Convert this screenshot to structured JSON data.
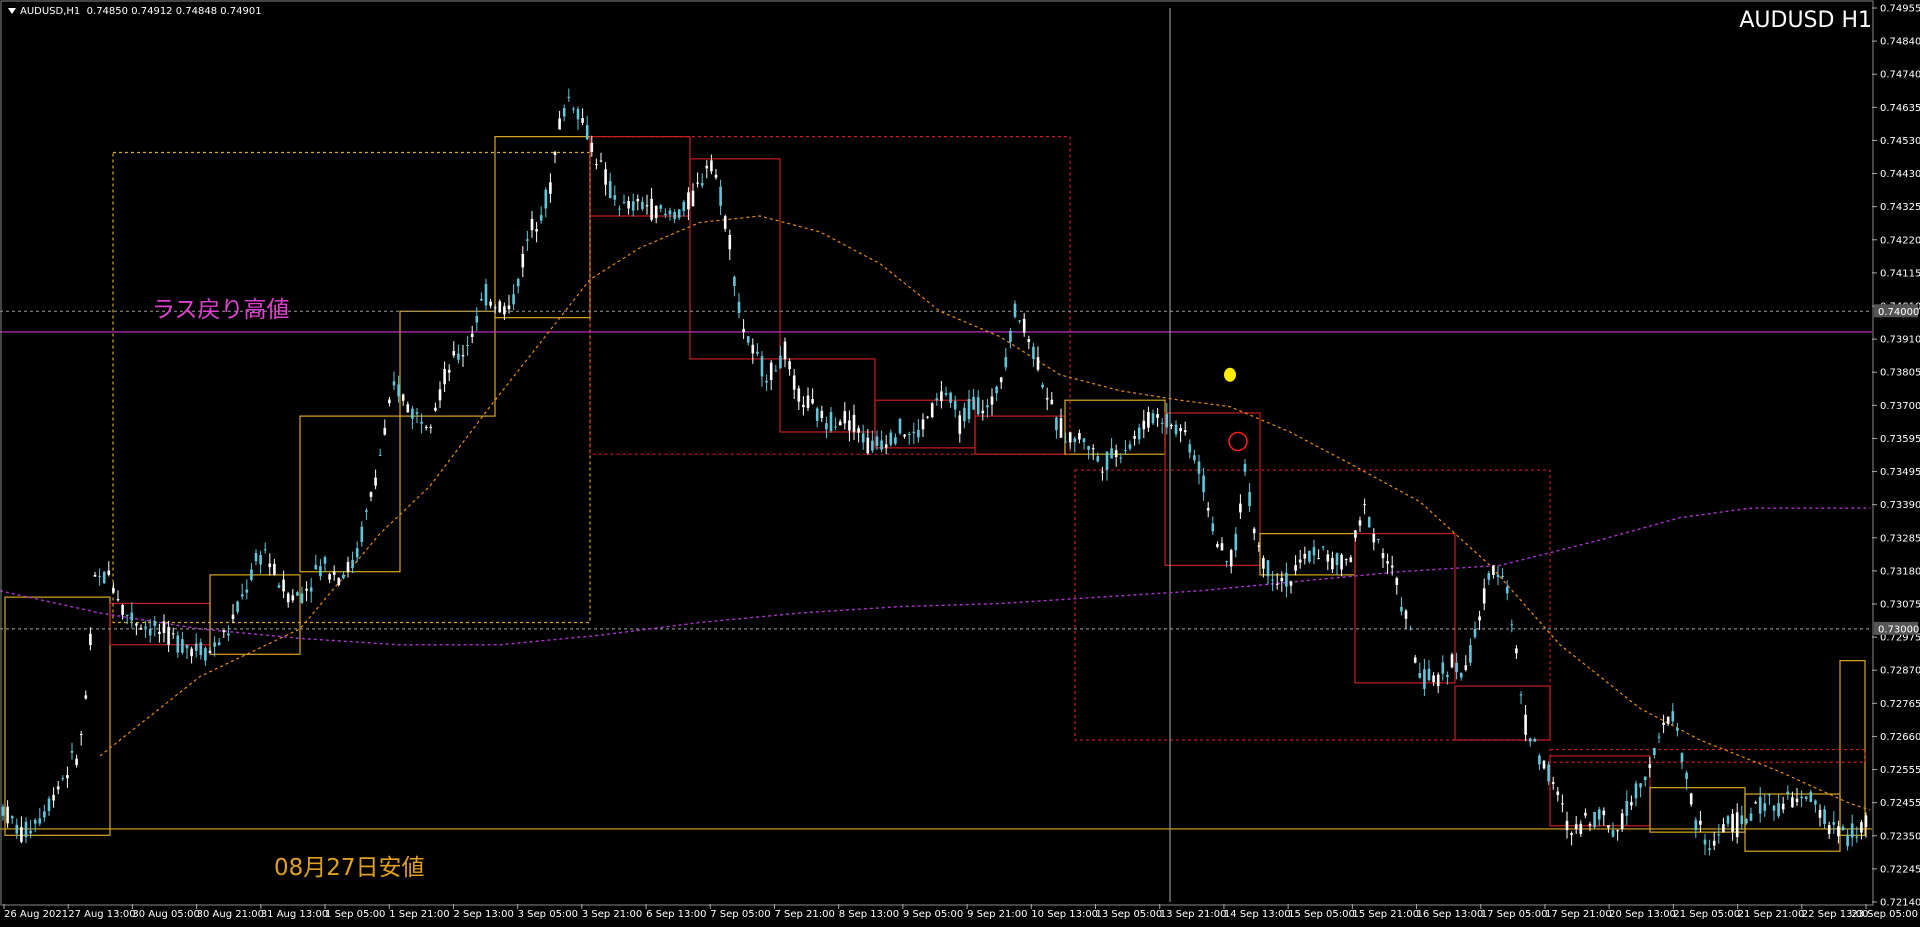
{
  "header": {
    "symbol": "AUDUSD,H1",
    "ohlc": "0.74850 0.74912 0.74848 0.74901"
  },
  "title_big": "AUDUSD H1",
  "annotations": {
    "resistance_label": "ラス戻り高値",
    "support_label": "08月27日安値"
  },
  "colors": {
    "background": "#000000",
    "candle": "#5fc8dc",
    "candle_bull": "#ffffff",
    "yellow": "#d8a820",
    "red": "#c81e1e",
    "magenta": "#cc33cc",
    "orange_ma": "#e88a1a",
    "purple_ma": "#aa33cc",
    "grid": "#777777"
  },
  "chart_data": {
    "type": "candlestick",
    "instrument": "AUDUSD",
    "timeframe": "H1",
    "ylim": [
      0.7214,
      0.74955
    ],
    "y_ticks": [
      "0.74955",
      "0.74840",
      "0.74740",
      "0.74635",
      "0.74530",
      "0.74430",
      "0.74325",
      "0.74220",
      "0.74115",
      "0.74010",
      "0.73910",
      "0.73805",
      "0.73700",
      "0.73595",
      "0.73495",
      "0.73390",
      "0.73285",
      "0.73180",
      "0.73075",
      "0.72975",
      "0.72870",
      "0.72765",
      "0.72660",
      "0.72555",
      "0.72455",
      "0.72350",
      "0.72245",
      "0.72140"
    ],
    "y_labels_highlight": [
      {
        "label": "0.74000",
        "value": 0.74
      },
      {
        "label": "0.73000",
        "value": 0.73
      }
    ],
    "x_labels": [
      "26 Aug 2021",
      "27 Aug 13:00",
      "30 Aug 05:00",
      "30 Aug 21:00",
      "31 Aug 13:00",
      "1 Sep 05:00",
      "1 Sep 21:00",
      "2 Sep 13:00",
      "3 Sep 05:00",
      "3 Sep 21:00",
      "6 Sep 13:00",
      "7 Sep 05:00",
      "7 Sep 21:00",
      "8 Sep 13:00",
      "9 Sep 05:00",
      "9 Sep 21:00",
      "10 Sep 13:00",
      "13 Sep 05:00",
      "13 Sep 21:00",
      "14 Sep 13:00",
      "15 Sep 05:00",
      "15 Sep 21:00",
      "16 Sep 13:00",
      "17 Sep 05:00",
      "17 Sep 21:00",
      "20 Sep 13:00",
      "21 Sep 05:00",
      "21 Sep 21:00",
      "22 Sep 13:00",
      "23 Sep 05:00"
    ],
    "price_path": [
      [
        0,
        0.7245
      ],
      [
        22,
        0.7235
      ],
      [
        45,
        0.7243
      ],
      [
        60,
        0.7252
      ],
      [
        80,
        0.7262
      ],
      [
        88,
        0.7285
      ],
      [
        95,
        0.7315
      ],
      [
        110,
        0.7317
      ],
      [
        125,
        0.7305
      ],
      [
        140,
        0.7302
      ],
      [
        160,
        0.7299
      ],
      [
        185,
        0.7295
      ],
      [
        210,
        0.7293
      ],
      [
        230,
        0.73
      ],
      [
        245,
        0.7312
      ],
      [
        255,
        0.732
      ],
      [
        265,
        0.7325
      ],
      [
        275,
        0.7317
      ],
      [
        285,
        0.7312
      ],
      [
        295,
        0.731
      ],
      [
        305,
        0.7312
      ],
      [
        315,
        0.7318
      ],
      [
        325,
        0.732
      ],
      [
        340,
        0.7317
      ],
      [
        355,
        0.7321
      ],
      [
        375,
        0.7347
      ],
      [
        395,
        0.7377
      ],
      [
        415,
        0.7367
      ],
      [
        430,
        0.7367
      ],
      [
        450,
        0.7383
      ],
      [
        465,
        0.7388
      ],
      [
        485,
        0.7405
      ],
      [
        510,
        0.74
      ],
      [
        530,
        0.7425
      ],
      [
        550,
        0.7438
      ],
      [
        560,
        0.746
      ],
      [
        570,
        0.7468
      ],
      [
        580,
        0.7462
      ],
      [
        595,
        0.745
      ],
      [
        610,
        0.7438
      ],
      [
        625,
        0.7432
      ],
      [
        645,
        0.7434
      ],
      [
        665,
        0.743
      ],
      [
        685,
        0.7432
      ],
      [
        700,
        0.744
      ],
      [
        710,
        0.745
      ],
      [
        720,
        0.7437
      ],
      [
        730,
        0.7422
      ],
      [
        740,
        0.7398
      ],
      [
        755,
        0.7385
      ],
      [
        770,
        0.738
      ],
      [
        785,
        0.7387
      ],
      [
        795,
        0.7375
      ],
      [
        810,
        0.737
      ],
      [
        825,
        0.7365
      ],
      [
        840,
        0.7367
      ],
      [
        855,
        0.7365
      ],
      [
        870,
        0.7357
      ],
      [
        885,
        0.736
      ],
      [
        900,
        0.7363
      ],
      [
        915,
        0.736
      ],
      [
        930,
        0.7368
      ],
      [
        945,
        0.7375
      ],
      [
        960,
        0.7365
      ],
      [
        975,
        0.7372
      ],
      [
        990,
        0.7368
      ],
      [
        1005,
        0.7385
      ],
      [
        1015,
        0.74
      ],
      [
        1025,
        0.7395
      ],
      [
        1040,
        0.7382
      ],
      [
        1055,
        0.7365
      ],
      [
        1070,
        0.736
      ],
      [
        1085,
        0.736
      ],
      [
        1100,
        0.7352
      ],
      [
        1115,
        0.7355
      ],
      [
        1135,
        0.736
      ],
      [
        1155,
        0.7368
      ],
      [
        1170,
        0.7365
      ],
      [
        1185,
        0.7362
      ],
      [
        1200,
        0.735
      ],
      [
        1215,
        0.733
      ],
      [
        1225,
        0.732
      ],
      [
        1235,
        0.7325
      ],
      [
        1245,
        0.735
      ],
      [
        1255,
        0.733
      ],
      [
        1265,
        0.732
      ],
      [
        1275,
        0.7317
      ],
      [
        1290,
        0.7315
      ],
      [
        1305,
        0.7322
      ],
      [
        1320,
        0.7325
      ],
      [
        1335,
        0.732
      ],
      [
        1350,
        0.7322
      ],
      [
        1365,
        0.7338
      ],
      [
        1375,
        0.733
      ],
      [
        1390,
        0.732
      ],
      [
        1405,
        0.7305
      ],
      [
        1420,
        0.7285
      ],
      [
        1435,
        0.7283
      ],
      [
        1450,
        0.729
      ],
      [
        1465,
        0.7285
      ],
      [
        1480,
        0.7305
      ],
      [
        1495,
        0.732
      ],
      [
        1505,
        0.7318
      ],
      [
        1515,
        0.7295
      ],
      [
        1525,
        0.727
      ],
      [
        1540,
        0.726
      ],
      [
        1555,
        0.725
      ],
      [
        1570,
        0.7235
      ],
      [
        1585,
        0.724
      ],
      [
        1600,
        0.7242
      ],
      [
        1615,
        0.7236
      ],
      [
        1630,
        0.7245
      ],
      [
        1645,
        0.7255
      ],
      [
        1660,
        0.7265
      ],
      [
        1672,
        0.7275
      ],
      [
        1685,
        0.7255
      ],
      [
        1695,
        0.724
      ],
      [
        1710,
        0.723
      ],
      [
        1725,
        0.724
      ],
      [
        1740,
        0.7238
      ],
      [
        1755,
        0.7243
      ],
      [
        1770,
        0.7245
      ],
      [
        1785,
        0.7245
      ],
      [
        1800,
        0.7246
      ],
      [
        1815,
        0.7245
      ],
      [
        1830,
        0.7238
      ],
      [
        1845,
        0.7235
      ],
      [
        1860,
        0.7236
      ],
      [
        1870,
        0.724
      ]
    ],
    "moving_average_orange": [
      [
        100,
        0.726
      ],
      [
        200,
        0.7285
      ],
      [
        300,
        0.73
      ],
      [
        380,
        0.733
      ],
      [
        430,
        0.7345
      ],
      [
        490,
        0.737
      ],
      [
        540,
        0.739
      ],
      [
        590,
        0.741
      ],
      [
        640,
        0.742
      ],
      [
        700,
        0.7428
      ],
      [
        760,
        0.743
      ],
      [
        820,
        0.7425
      ],
      [
        880,
        0.7415
      ],
      [
        940,
        0.74
      ],
      [
        1000,
        0.7392
      ],
      [
        1060,
        0.738
      ],
      [
        1120,
        0.7375
      ],
      [
        1180,
        0.7372
      ],
      [
        1230,
        0.737
      ],
      [
        1290,
        0.7362
      ],
      [
        1350,
        0.7352
      ],
      [
        1420,
        0.734
      ],
      [
        1490,
        0.732
      ],
      [
        1560,
        0.7295
      ],
      [
        1640,
        0.7275
      ],
      [
        1700,
        0.7265
      ],
      [
        1780,
        0.7255
      ],
      [
        1850,
        0.7245
      ],
      [
        1870,
        0.7243
      ]
    ],
    "moving_average_purple": [
      [
        0,
        0.7312
      ],
      [
        100,
        0.7305
      ],
      [
        200,
        0.73
      ],
      [
        300,
        0.7297
      ],
      [
        400,
        0.7295
      ],
      [
        500,
        0.7295
      ],
      [
        600,
        0.7298
      ],
      [
        700,
        0.7302
      ],
      [
        800,
        0.7305
      ],
      [
        900,
        0.7307
      ],
      [
        1000,
        0.7308
      ],
      [
        1100,
        0.731
      ],
      [
        1200,
        0.7312
      ],
      [
        1300,
        0.7315
      ],
      [
        1400,
        0.7318
      ],
      [
        1500,
        0.732
      ],
      [
        1600,
        0.7328
      ],
      [
        1680,
        0.7335
      ],
      [
        1750,
        0.7338
      ],
      [
        1800,
        0.7338
      ],
      [
        1870,
        0.7338
      ]
    ],
    "horizontal_lines": [
      {
        "name": "last-pullback-high",
        "value": 0.73935,
        "color": "#cc33cc",
        "style": "solid"
      },
      {
        "name": "aug27-low",
        "value": 0.7237,
        "color": "#d8a820",
        "style": "solid"
      },
      {
        "name": "grid-074",
        "value": 0.74,
        "color": "#888888",
        "style": "dashed"
      },
      {
        "name": "grid-073",
        "value": 0.73,
        "color": "#888888",
        "style": "dashed"
      }
    ],
    "boxes": [
      {
        "x0": 5,
        "x1": 110,
        "high": 0.731,
        "low": 0.7235,
        "color": "yellow",
        "style": "solid"
      },
      {
        "x0": 110,
        "x1": 210,
        "high": 0.7308,
        "low": 0.7295,
        "color": "red",
        "style": "solid"
      },
      {
        "x0": 210,
        "x1": 300,
        "high": 0.7317,
        "low": 0.7292,
        "color": "yellow",
        "style": "solid"
      },
      {
        "x0": 300,
        "x1": 400,
        "high": 0.7367,
        "low": 0.7318,
        "color": "yellow",
        "style": "solid"
      },
      {
        "x0": 400,
        "x1": 495,
        "high": 0.74,
        "low": 0.7367,
        "color": "yellow",
        "style": "solid"
      },
      {
        "x0": 495,
        "x1": 590,
        "high": 0.7455,
        "low": 0.7398,
        "color": "yellow",
        "style": "solid"
      },
      {
        "x0": 590,
        "x1": 690,
        "high": 0.7455,
        "low": 0.743,
        "color": "red",
        "style": "solid"
      },
      {
        "x0": 690,
        "x1": 780,
        "high": 0.7448,
        "low": 0.7385,
        "color": "red",
        "style": "solid"
      },
      {
        "x0": 780,
        "x1": 875,
        "high": 0.7385,
        "low": 0.7362,
        "color": "red",
        "style": "solid"
      },
      {
        "x0": 875,
        "x1": 975,
        "high": 0.7372,
        "low": 0.7357,
        "color": "red",
        "style": "solid"
      },
      {
        "x0": 975,
        "x1": 1065,
        "high": 0.7367,
        "low": 0.7355,
        "color": "red",
        "style": "solid"
      },
      {
        "x0": 1065,
        "x1": 1165,
        "high": 0.7372,
        "low": 0.7355,
        "color": "yellow",
        "style": "solid"
      },
      {
        "x0": 1165,
        "x1": 1260,
        "high": 0.7368,
        "low": 0.732,
        "color": "red",
        "style": "solid"
      },
      {
        "x0": 1260,
        "x1": 1355,
        "high": 0.733,
        "low": 0.7317,
        "color": "yellow",
        "style": "solid"
      },
      {
        "x0": 1355,
        "x1": 1455,
        "high": 0.733,
        "low": 0.7283,
        "color": "red",
        "style": "solid"
      },
      {
        "x0": 1455,
        "x1": 1550,
        "high": 0.7282,
        "low": 0.7265,
        "color": "red",
        "style": "solid"
      },
      {
        "x0": 1550,
        "x1": 1650,
        "high": 0.726,
        "low": 0.7238,
        "color": "red",
        "style": "solid"
      },
      {
        "x0": 1650,
        "x1": 1745,
        "high": 0.725,
        "low": 0.7236,
        "color": "yellow",
        "style": "solid"
      },
      {
        "x0": 1745,
        "x1": 1840,
        "high": 0.7248,
        "low": 0.723,
        "color": "yellow",
        "style": "solid"
      },
      {
        "x0": 1840,
        "x1": 1865,
        "high": 0.729,
        "low": 0.7235,
        "color": "yellow",
        "style": "solid"
      },
      {
        "x0": 113,
        "x1": 590,
        "high": 0.745,
        "low": 0.7302,
        "color": "yellow",
        "style": "dashed"
      },
      {
        "x0": 590,
        "x1": 1070,
        "high": 0.7455,
        "low": 0.7355,
        "color": "red",
        "style": "dashed"
      },
      {
        "x0": 1075,
        "x1": 1550,
        "high": 0.735,
        "low": 0.7265,
        "color": "red",
        "style": "dashed"
      },
      {
        "x0": 1550,
        "x1": 1865,
        "high": 0.7262,
        "low": 0.7258,
        "color": "red",
        "style": "dashed"
      }
    ],
    "vertical_cursor_x": 1170,
    "markers": [
      {
        "name": "yellow-dot",
        "x": 1230,
        "value": 0.738,
        "color": "#ffee00"
      },
      {
        "name": "red-circle",
        "x": 1238,
        "value": 0.7359,
        "color": "#ff2020"
      }
    ]
  }
}
